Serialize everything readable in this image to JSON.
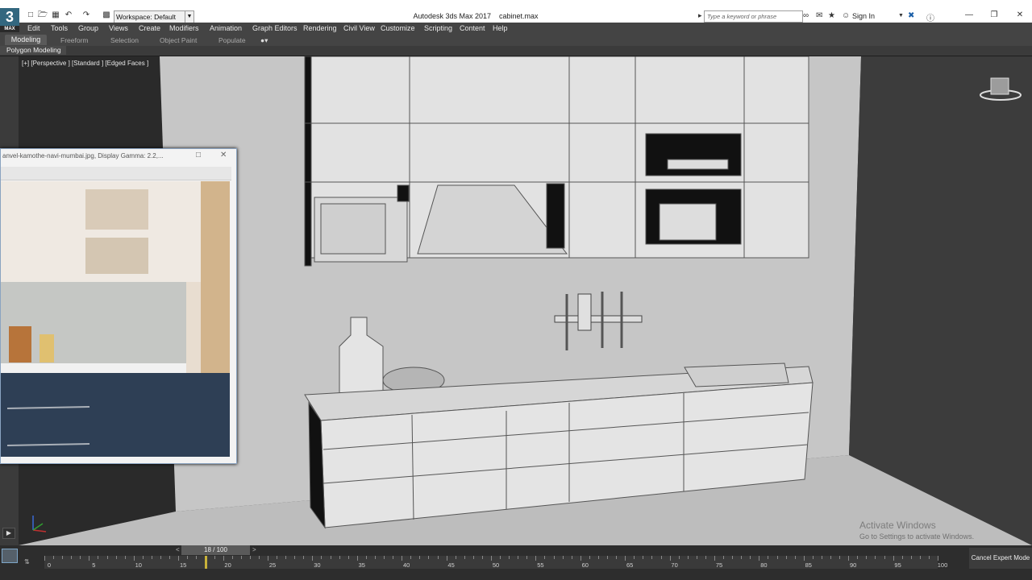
{
  "titlebar": {
    "app_logo": "3",
    "app_logo_sub": "MAX",
    "workspace": "Workspace: Default",
    "app_title": "Autodesk 3ds Max 2017",
    "file_name": "cabinet.max",
    "search_placeholder": "Type a keyword or phrase",
    "sign_in": "Sign In"
  },
  "menu": [
    "Edit",
    "Tools",
    "Group",
    "Views",
    "Create",
    "Modifiers",
    "Animation",
    "Graph Editors",
    "Rendering",
    "Civil View",
    "Customize",
    "Scripting",
    "Content",
    "Help"
  ],
  "ribbon": {
    "tabs": [
      "Modeling",
      "Freeform",
      "Selection",
      "Object Paint",
      "Populate"
    ],
    "active_tab": "Modeling",
    "panel": "Polygon Modeling"
  },
  "viewport": {
    "label": "[+] [Perspective ] [Standard ] [Edged Faces ]"
  },
  "image_window": {
    "title": "anvel-kamothe-navi-mumbai.jpg, Display Gamma: 2.2,..."
  },
  "timeline": {
    "frame_display": "18 / 100",
    "current_frame": 18,
    "total_frames": 100,
    "tick_labels": [
      "0",
      "5",
      "10",
      "15",
      "20",
      "25",
      "30",
      "35",
      "40",
      "45",
      "50",
      "55",
      "60",
      "65",
      "70",
      "75",
      "80",
      "85",
      "90",
      "95",
      "100"
    ],
    "cancel_expert": "Cancel Expert Mode"
  },
  "watermark": {
    "title": "Activate Windows",
    "subtitle": "Go to Settings to activate Windows."
  },
  "colors": {
    "accent": "#7ea6c8",
    "viewport_bg": "#404040",
    "timeline_marker": "#c9b23a"
  }
}
